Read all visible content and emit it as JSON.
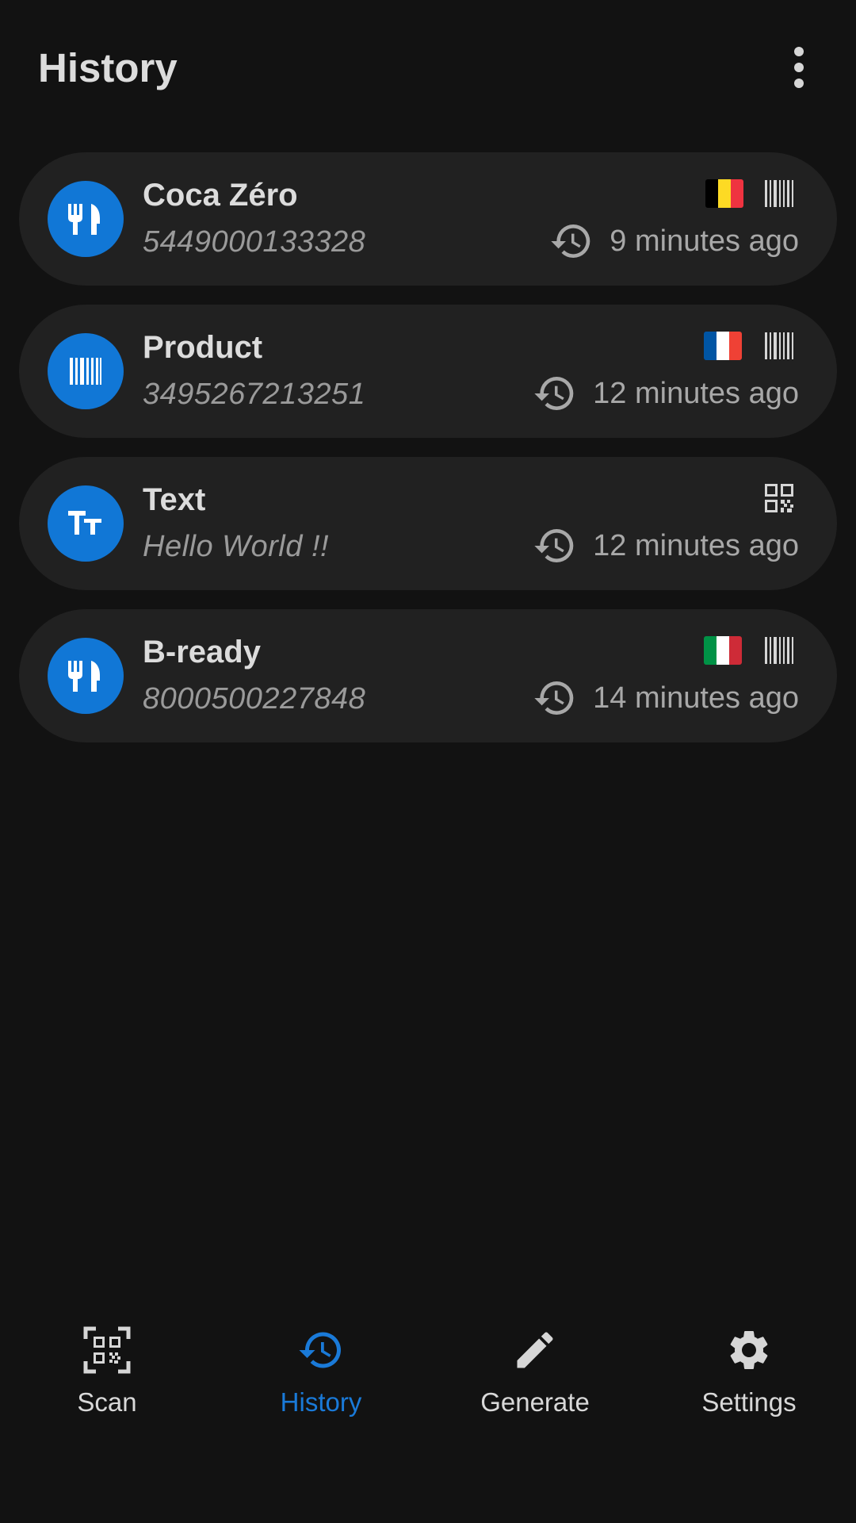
{
  "header": {
    "title": "History",
    "overflow_icon": "more-vert-icon"
  },
  "history": {
    "items": [
      {
        "icon": "restaurant-icon",
        "title": "Coca Zéro",
        "subtitle": "5449000133328",
        "flag": "belgium-flag",
        "flag_colors": [
          "#000000",
          "#FDDA24",
          "#EF3340"
        ],
        "format_icon": "barcode-icon",
        "time_icon": "history-icon",
        "time": "9 minutes ago"
      },
      {
        "icon": "barcode-icon",
        "title": "Product",
        "subtitle": "3495267213251",
        "flag": "france-flag",
        "flag_colors": [
          "#0055A4",
          "#FFFFFF",
          "#EF4135"
        ],
        "format_icon": "barcode-icon",
        "time_icon": "history-icon",
        "time": "12 minutes ago"
      },
      {
        "icon": "text-fields-icon",
        "title": "Text",
        "subtitle": "Hello World !!",
        "format_icon": "qr-code-icon",
        "time_icon": "history-icon",
        "time": "12 minutes ago"
      },
      {
        "icon": "restaurant-icon",
        "title": "B-ready",
        "subtitle": "8000500227848",
        "flag": "italy-flag",
        "flag_colors": [
          "#009246",
          "#FFFFFF",
          "#CE2B37"
        ],
        "format_icon": "barcode-icon",
        "time_icon": "history-icon",
        "time": "14 minutes ago"
      }
    ]
  },
  "bottom_nav": {
    "items": [
      {
        "label": "Scan",
        "icon": "qr-scanner-icon",
        "active": false
      },
      {
        "label": "History",
        "icon": "history-icon",
        "active": true
      },
      {
        "label": "Generate",
        "icon": "edit-icon",
        "active": false
      },
      {
        "label": "Settings",
        "icon": "settings-icon",
        "active": false
      }
    ]
  },
  "colors": {
    "background": "#121212",
    "card": "#212121",
    "accent": "#1177d6",
    "active_nav": "#1a7ad8",
    "primary_text": "#dcdcdc",
    "secondary_text": "#9a9a9a"
  }
}
